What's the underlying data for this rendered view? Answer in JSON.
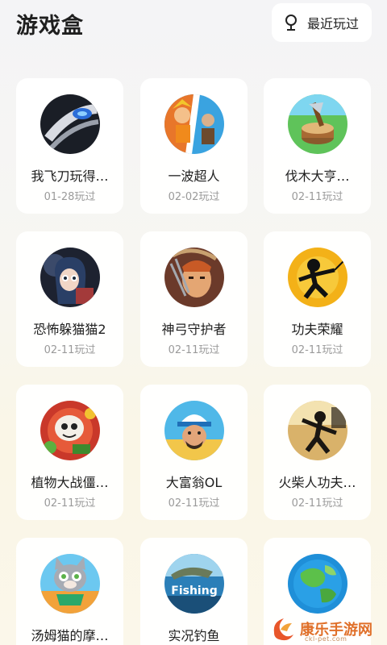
{
  "header": {
    "title": "游戏盒",
    "recent_label": "最近玩过"
  },
  "games": [
    {
      "name": "我飞刀玩得…",
      "date": "01-28玩过",
      "icon": "knife-game-icon"
    },
    {
      "name": "一波超人",
      "date": "02-02玩过",
      "icon": "superhero-game-icon"
    },
    {
      "name": "伐木大亨…",
      "date": "02-11玩过",
      "icon": "lumber-game-icon"
    },
    {
      "name": "恐怖躲猫猫2",
      "date": "02-11玩过",
      "icon": "horror-game-icon"
    },
    {
      "name": "神弓守护者",
      "date": "02-11玩过",
      "icon": "archer-game-icon"
    },
    {
      "name": "功夫荣耀",
      "date": "02-11玩过",
      "icon": "kungfu-game-icon"
    },
    {
      "name": "植物大战僵…",
      "date": "02-11玩过",
      "icon": "plants-zombies-game-icon"
    },
    {
      "name": "大富翁OL",
      "date": "02-11玩过",
      "icon": "monopoly-game-icon"
    },
    {
      "name": "火柴人功夫…",
      "date": "02-11玩过",
      "icon": "stickman-game-icon"
    },
    {
      "name": "汤姆猫的摩…",
      "date": "",
      "icon": "tom-cat-game-icon"
    },
    {
      "name": "实况钓鱼",
      "date": "",
      "icon": "fishing-game-icon"
    },
    {
      "name": "",
      "date": "",
      "icon": "earth-game-icon"
    }
  ],
  "fishing_logo_text": "Fishing",
  "watermark": {
    "text": "康乐手游网",
    "sub": "ckl-pet.com"
  }
}
